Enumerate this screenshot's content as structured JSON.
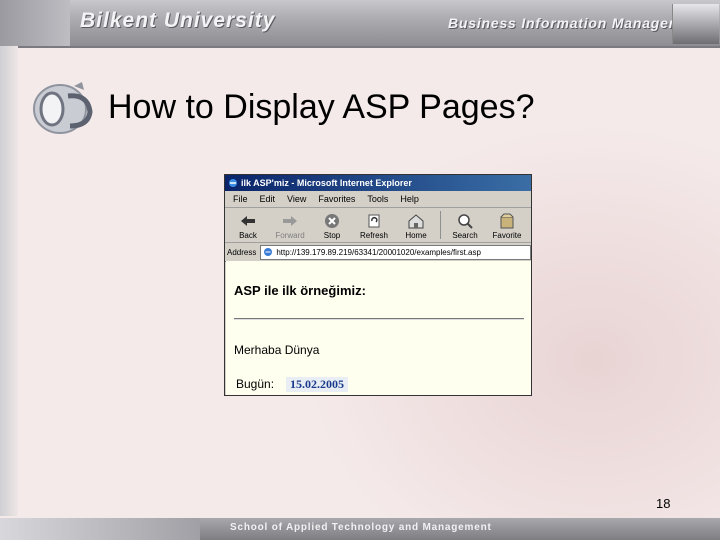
{
  "header": {
    "university": "Bilkent University",
    "department": "Business Information Management"
  },
  "slide": {
    "title": "How to Display ASP Pages?",
    "page_number": "18"
  },
  "footer": {
    "school": "School of Applied Technology and Management"
  },
  "browser": {
    "window_title": "ilk ASP'miz - Microsoft Internet Explorer",
    "menu": [
      "File",
      "Edit",
      "View",
      "Favorites",
      "Tools",
      "Help"
    ],
    "toolbar": [
      {
        "label": "Back",
        "icon": "back-arrow-icon",
        "enabled": true
      },
      {
        "label": "Forward",
        "icon": "forward-arrow-icon",
        "enabled": false
      },
      {
        "label": "Stop",
        "icon": "stop-icon",
        "enabled": true
      },
      {
        "label": "Refresh",
        "icon": "refresh-icon",
        "enabled": true
      },
      {
        "label": "Home",
        "icon": "home-icon",
        "enabled": true
      },
      {
        "label": "Search",
        "icon": "search-icon",
        "enabled": true
      },
      {
        "label": "Favorite",
        "icon": "favorites-icon",
        "enabled": true
      }
    ],
    "address_label": "Address",
    "address_url": "http://139.179.89.219/63341/20001020/examples/first.asp",
    "page": {
      "heading": "ASP ile ilk örneğimiz:",
      "greeting": "Merhaba Dünya",
      "date_label": "Bugün:",
      "date_value": "15.02.2005"
    }
  }
}
